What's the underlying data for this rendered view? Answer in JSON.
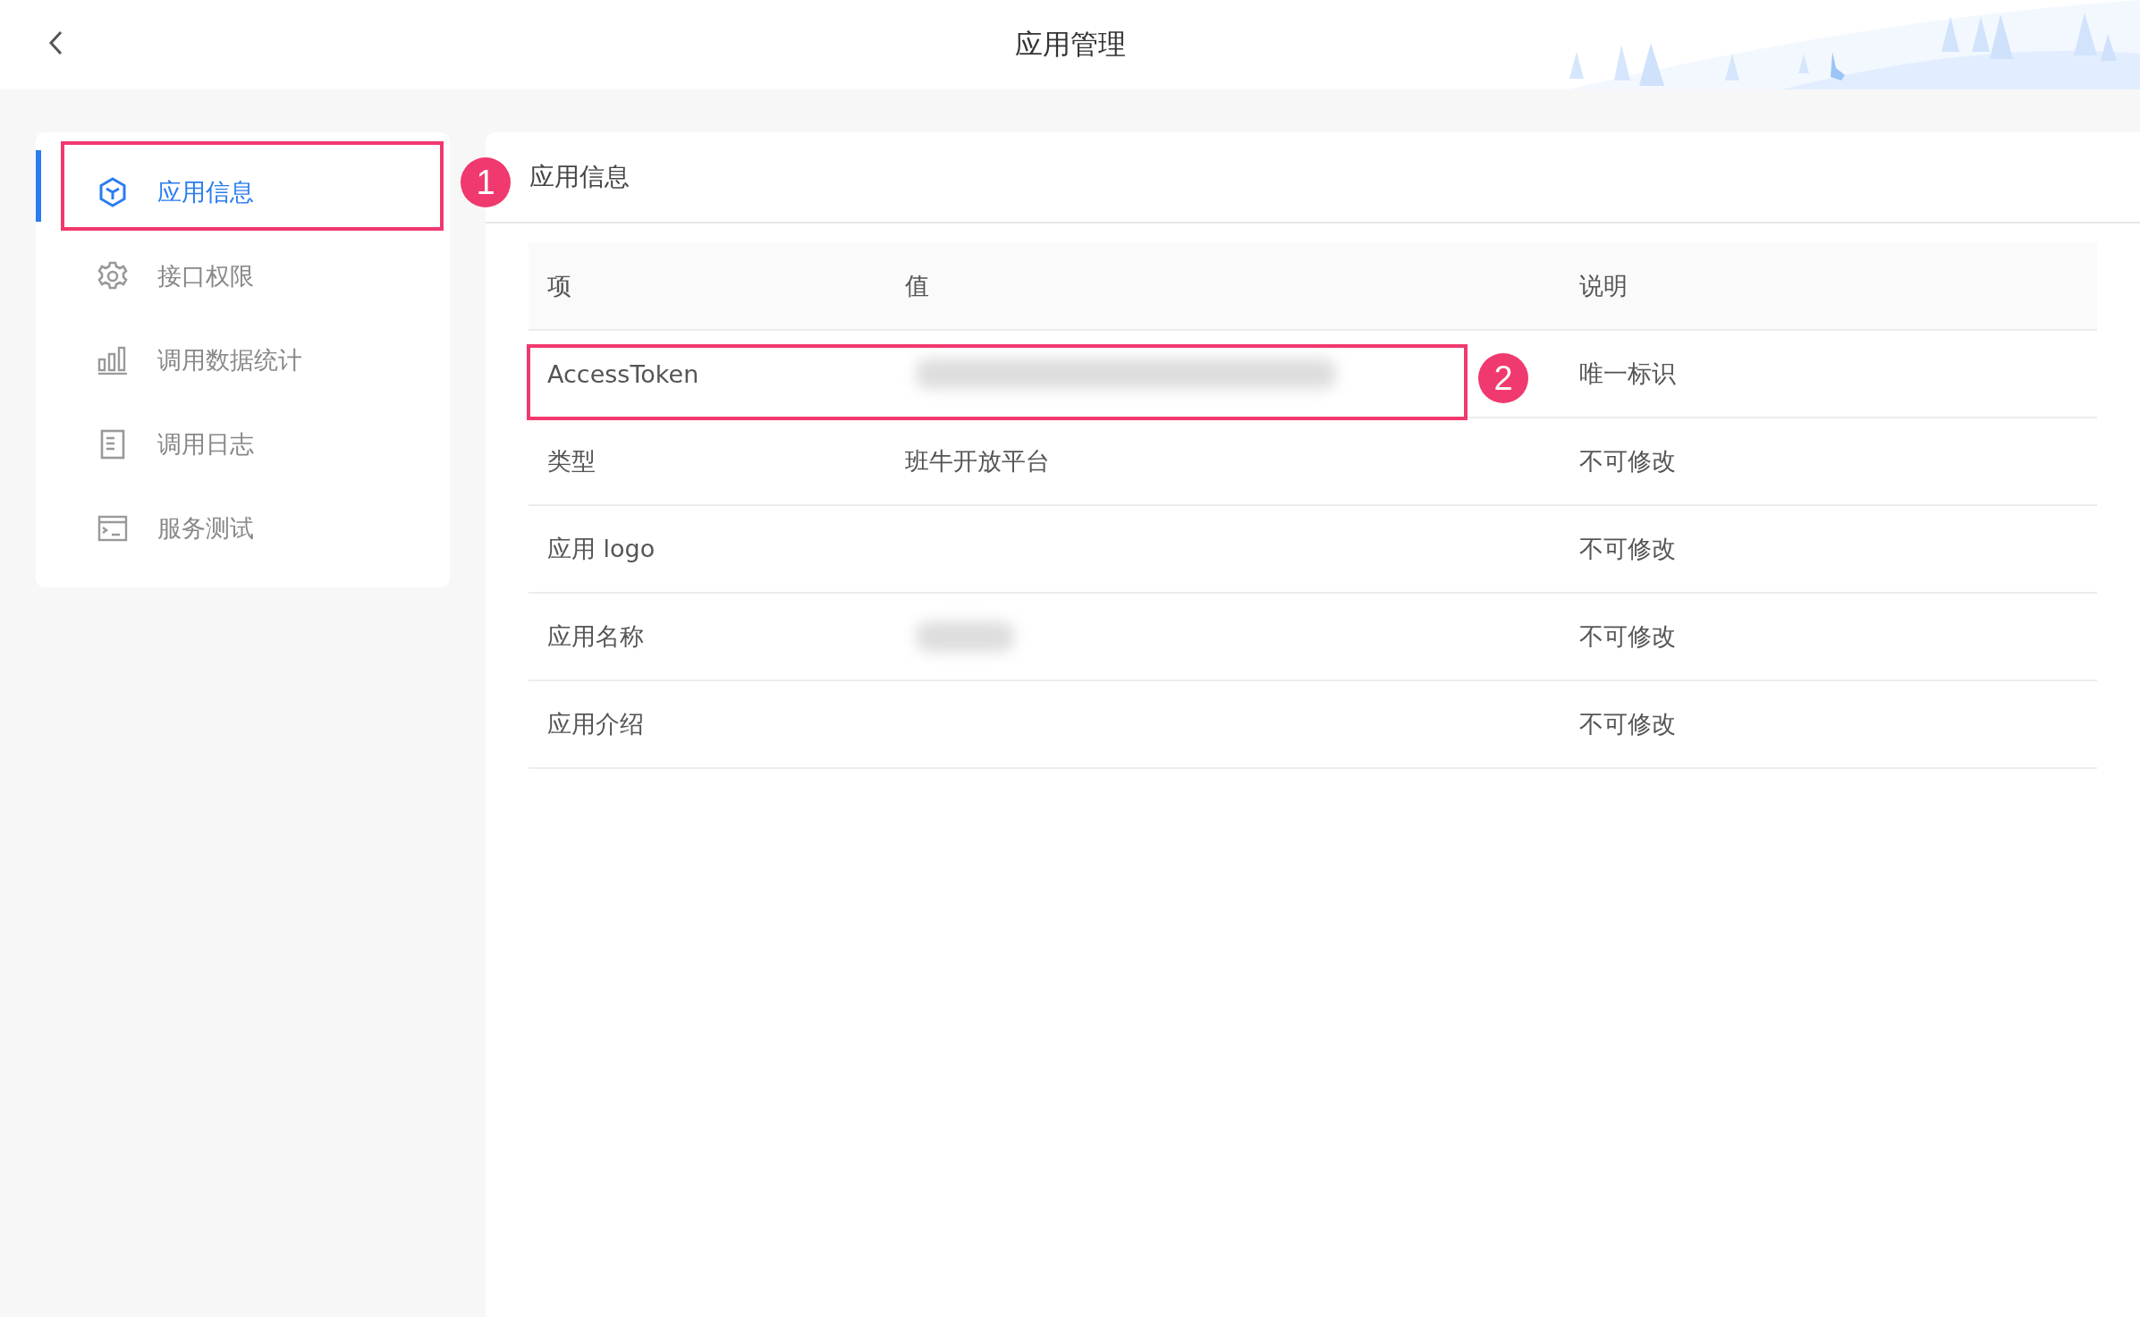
{
  "header": {
    "title": "应用管理"
  },
  "sidebar": {
    "items": [
      {
        "label": "应用信息",
        "selected": true
      },
      {
        "label": "接口权限",
        "selected": false
      },
      {
        "label": "调用数据统计",
        "selected": false
      },
      {
        "label": "调用日志",
        "selected": false
      },
      {
        "label": "服务测试",
        "selected": false
      }
    ]
  },
  "panel": {
    "title": "应用信息"
  },
  "table": {
    "columns": [
      "项",
      "值",
      "说明"
    ],
    "rows": [
      {
        "item": "AccessToken",
        "redacted": true,
        "note": "唯一标识"
      },
      {
        "item": "类型",
        "value": "班牛开放平台",
        "note": "不可修改"
      },
      {
        "item": "应用 logo",
        "note": "不可修改"
      },
      {
        "item": "应用名称",
        "redacted": true,
        "note": "不可修改"
      },
      {
        "item": "应用介绍",
        "note": "不可修改"
      }
    ]
  },
  "callouts": [
    "1",
    "2"
  ]
}
